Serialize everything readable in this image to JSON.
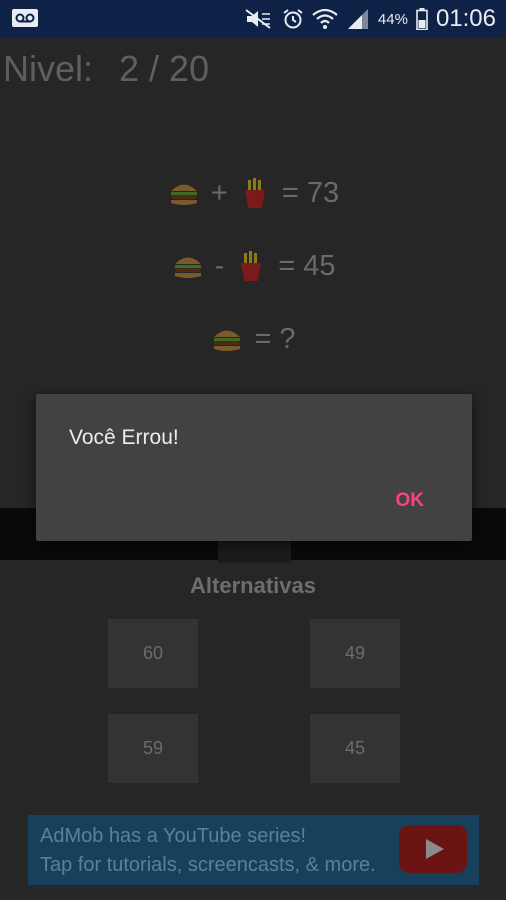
{
  "status_bar": {
    "left_icon": "voicemail-icon",
    "icons": [
      "mute-icon",
      "alarm-icon",
      "wifi-icon",
      "signal-icon"
    ],
    "battery": "44%",
    "time": "01:06"
  },
  "game": {
    "level_label": "Nivel:",
    "level_value": "2 / 20",
    "equations": [
      {
        "a": "burger-icon",
        "op": "+",
        "b": "fries-icon",
        "result": "= 73"
      },
      {
        "a": "burger-icon",
        "op": "-",
        "b": "fries-icon",
        "result": "= 45"
      },
      {
        "a": "burger-icon",
        "result": "= ?"
      }
    ],
    "alternatives_title": "Alternativas",
    "alternatives": [
      "60",
      "49",
      "59",
      "45"
    ]
  },
  "ad": {
    "line1": "AdMob has a YouTube series!",
    "line2": "Tap for tutorials, screencasts, & more.",
    "icon": "youtube-play-icon"
  },
  "dialog": {
    "message": "Você Errou!",
    "ok_label": "OK",
    "ok_color": "#ff4081"
  }
}
